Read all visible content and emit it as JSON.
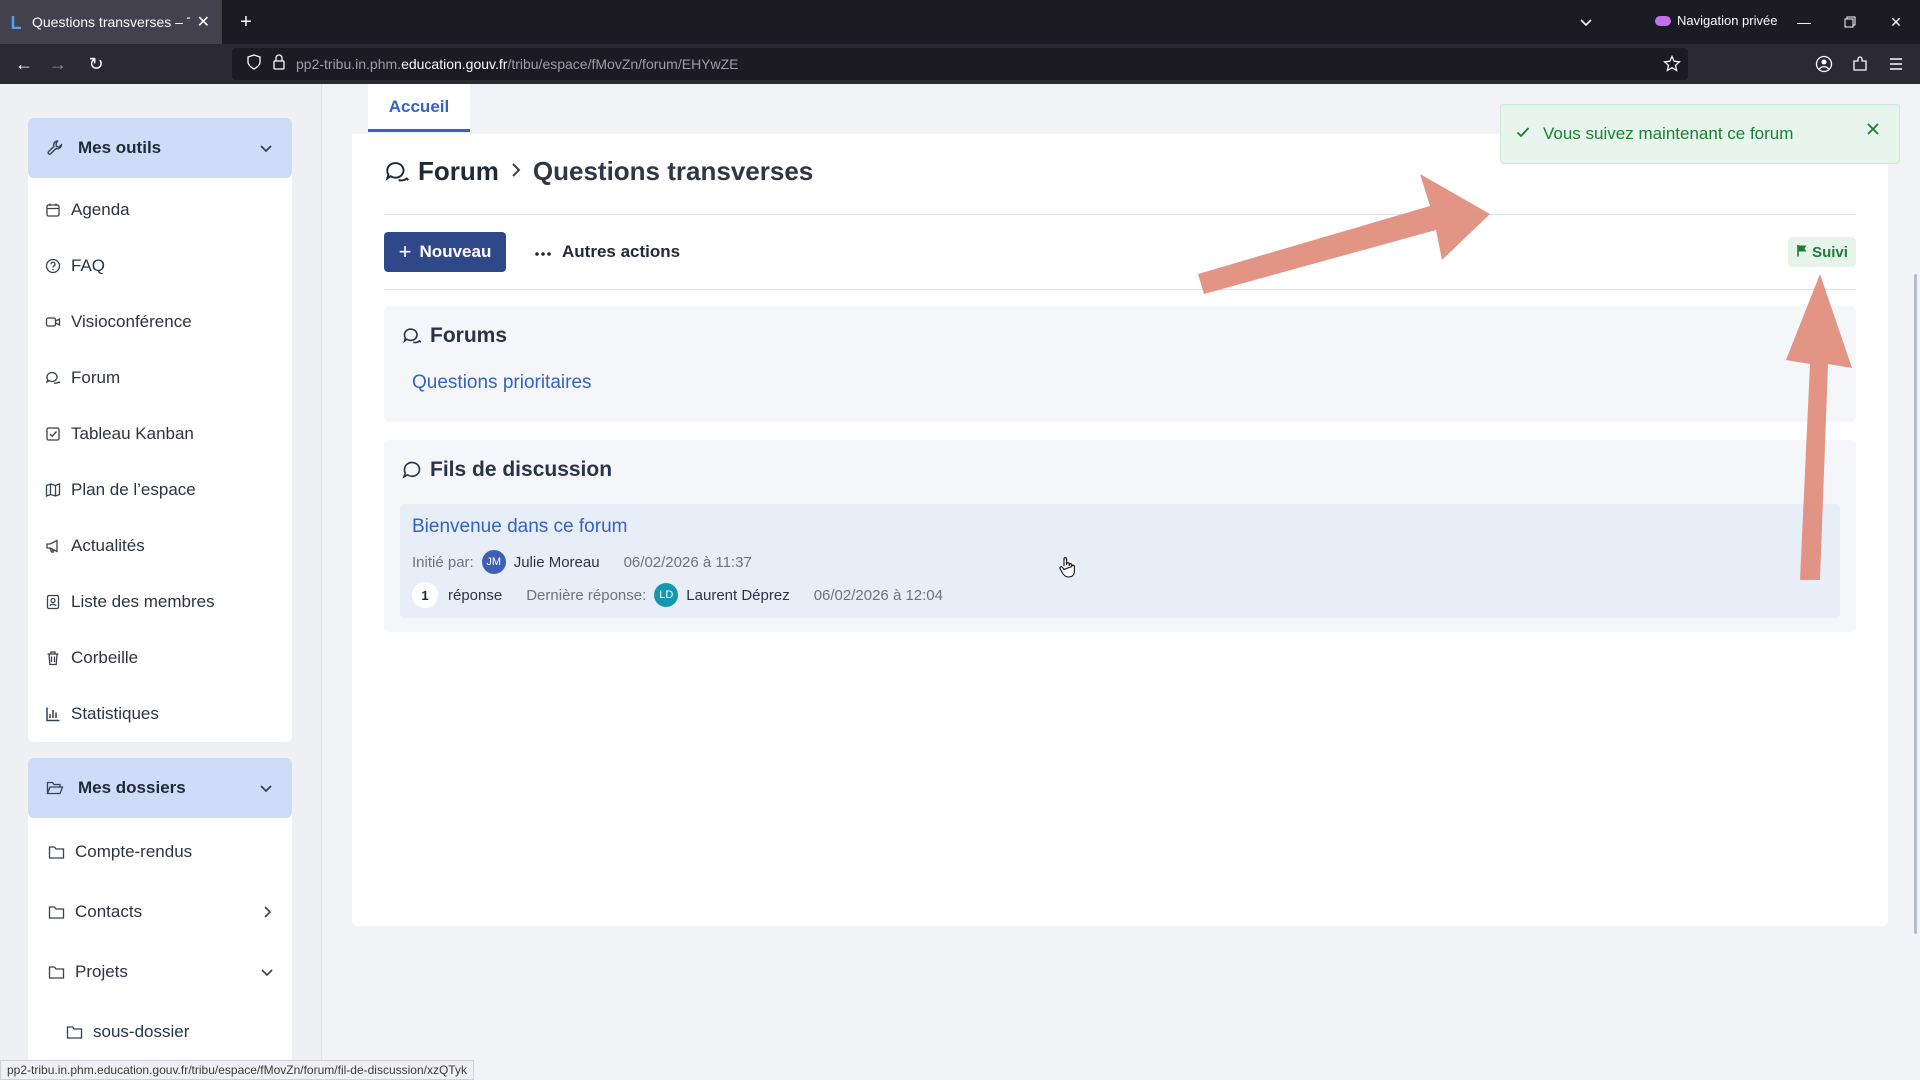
{
  "browser": {
    "tab_title": "Questions transverses – Tribu",
    "private_label": "Navigation privée",
    "url_prefix": "pp2-tribu.in.phm.",
    "url_host": "education.gouv.fr",
    "url_path": "/tribu/espace/fMovZn/forum/EHYwZE",
    "status_url": "pp2-tribu.in.phm.education.gouv.fr/tribu/espace/fMovZn/forum/fil-de-discussion/xzQTyk"
  },
  "sidebar": {
    "tools_header": "Mes outils",
    "tools": [
      {
        "label": "Agenda",
        "icon": "calendar-icon"
      },
      {
        "label": "FAQ",
        "icon": "help-circle-icon"
      },
      {
        "label": "Visioconférence",
        "icon": "video-icon"
      },
      {
        "label": "Forum",
        "icon": "chat-bubbles-icon"
      },
      {
        "label": "Tableau Kanban",
        "icon": "checkbox-icon"
      },
      {
        "label": "Plan de l’espace",
        "icon": "map-icon"
      },
      {
        "label": "Actualités",
        "icon": "megaphone-icon"
      },
      {
        "label": "Liste des membres",
        "icon": "contacts-icon"
      },
      {
        "label": "Corbeille",
        "icon": "trash-icon"
      },
      {
        "label": "Statistiques",
        "icon": "bar-chart-icon"
      }
    ],
    "folders_header": "Mes dossiers",
    "folders": [
      {
        "label": "Compte-rendus"
      },
      {
        "label": "Contacts"
      },
      {
        "label": "Projets"
      },
      {
        "label": "sous-dossier"
      }
    ]
  },
  "main": {
    "tab_label": "Accueil",
    "breadcrumb_root": "Forum",
    "breadcrumb_current": "Questions transverses",
    "new_button": "Nouveau",
    "more_actions": "Autres actions",
    "follow_badge": "Suivi",
    "forums_title": "Forums",
    "forums": [
      "Questions prioritaires"
    ],
    "threads_title": "Fils de discussion",
    "thread": {
      "title": "Bienvenue dans ce forum",
      "initiated_label": "Initié par:",
      "author_initials": "JM",
      "author": "Julie Moreau",
      "created": "06/02/2026 à 11:37",
      "reply_count": "1",
      "reply_label": "réponse",
      "last_reply_label": "Dernière réponse:",
      "last_initials": "LD",
      "last_author": "Laurent Déprez",
      "last_date": "06/02/2026 à 12:04"
    }
  },
  "toast": {
    "message": "Vous suivez maintenant ce forum"
  },
  "colors": {
    "primary": "#2f4889",
    "link": "#3562c4",
    "success": "#1a7f37",
    "annotation_arrow": "#e08a78"
  }
}
